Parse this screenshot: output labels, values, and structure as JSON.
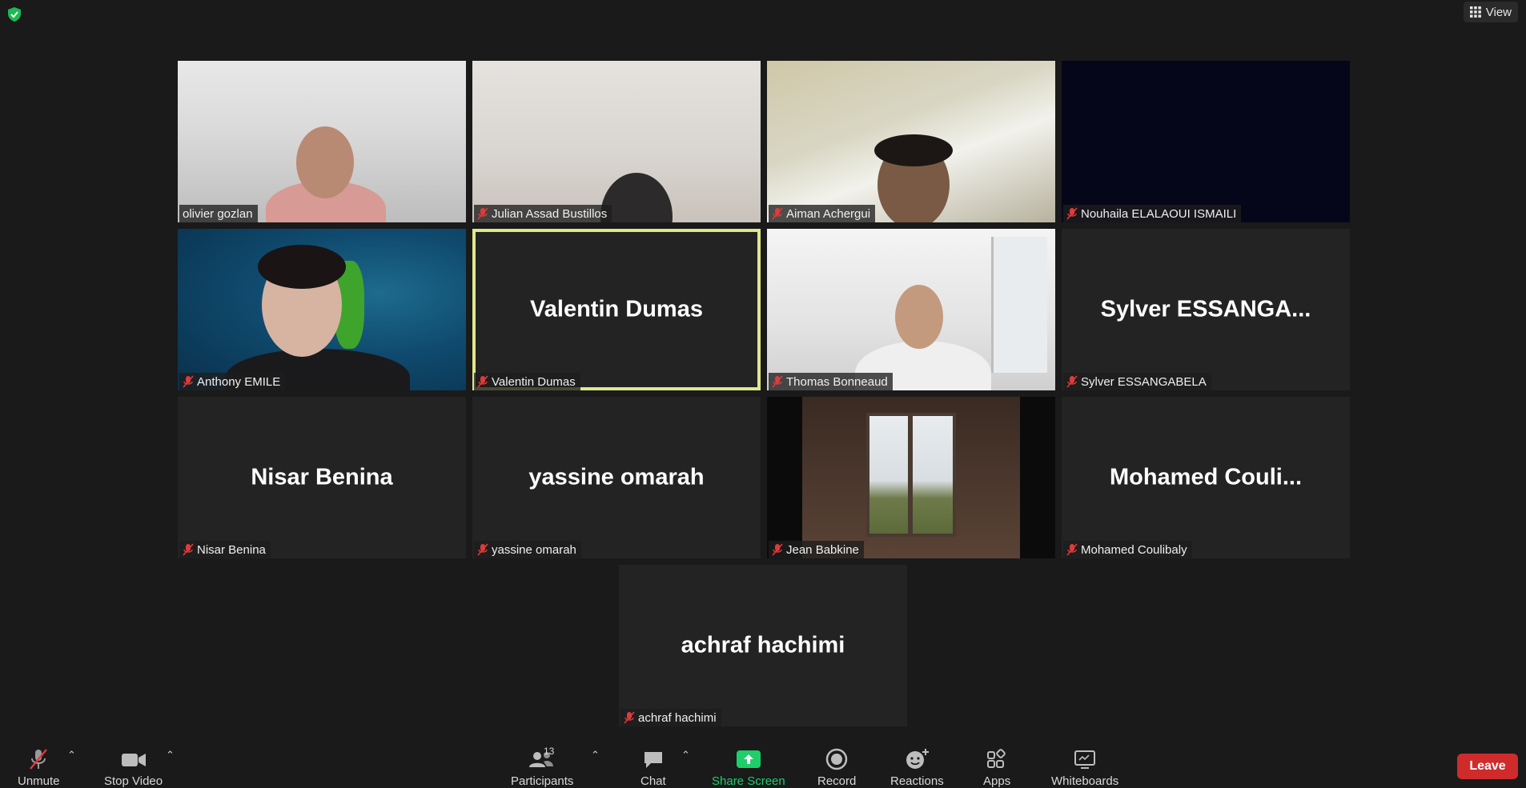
{
  "top": {
    "view_label": "View"
  },
  "participants": [
    {
      "label": "olivier gozlan",
      "muted": false,
      "display": ""
    },
    {
      "label": "Julian Assad Bustillos",
      "muted": true,
      "display": ""
    },
    {
      "label": "Aiman Achergui",
      "muted": true,
      "display": ""
    },
    {
      "label": "Nouhaila ELALAOUI ISMAILI",
      "muted": true,
      "display": ""
    },
    {
      "label": "Anthony EMILE",
      "muted": true,
      "display": ""
    },
    {
      "label": "Valentin Dumas",
      "muted": true,
      "display": "Valentin Dumas",
      "active_speaker": true
    },
    {
      "label": "Thomas Bonneaud",
      "muted": true,
      "display": ""
    },
    {
      "label": "Sylver ESSANGABELA",
      "muted": true,
      "display": "Sylver  ESSANGA..."
    },
    {
      "label": "Nisar Benina",
      "muted": true,
      "display": "Nisar Benina"
    },
    {
      "label": "yassine omarah",
      "muted": true,
      "display": "yassine omarah"
    },
    {
      "label": "Jean Babkine",
      "muted": true,
      "display": ""
    },
    {
      "label": "Mohamed Coulibaly",
      "muted": true,
      "display": "Mohamed  Couli..."
    },
    {
      "label": "achraf hachimi",
      "muted": true,
      "display": "achraf hachimi"
    }
  ],
  "toolbar": {
    "unmute": "Unmute",
    "stop_video": "Stop Video",
    "participants": "Participants",
    "participants_count": "13",
    "chat": "Chat",
    "share_screen": "Share Screen",
    "record": "Record",
    "reactions": "Reactions",
    "apps": "Apps",
    "whiteboards": "Whiteboards",
    "leave": "Leave"
  },
  "colors": {
    "leave": "#cf2b2b",
    "share_green": "#1dce6a",
    "active_border": "#dfe88a",
    "mute_red": "#e03a3a"
  }
}
